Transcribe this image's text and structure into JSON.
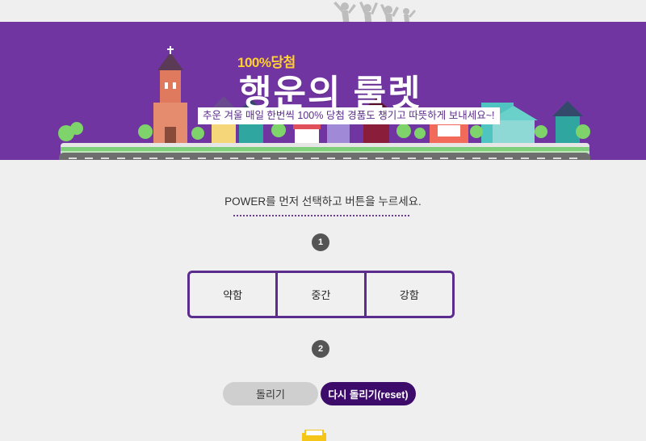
{
  "banner": {
    "promo": "100%당첨",
    "title": "행운의 룰렛",
    "subtitle": "추운 겨울 매일 한번씩 100% 당첨  경품도 챙기고 따뜻하게 보내세요~!",
    "background_color": "#7035a0"
  },
  "instruction": "POWER를 먼저 선택하고 버튼을 누르세요.",
  "steps": [
    "1",
    "2"
  ],
  "power_options": [
    {
      "label": "약함"
    },
    {
      "label": "중간"
    },
    {
      "label": "강함"
    }
  ],
  "buttons": {
    "spin": "돌리기",
    "reset": "다시 돌리기(reset)"
  },
  "colors": {
    "accent": "#5b2c8e",
    "reset_button": "#3d0c6b",
    "spin_button": "#cfcfcf"
  }
}
